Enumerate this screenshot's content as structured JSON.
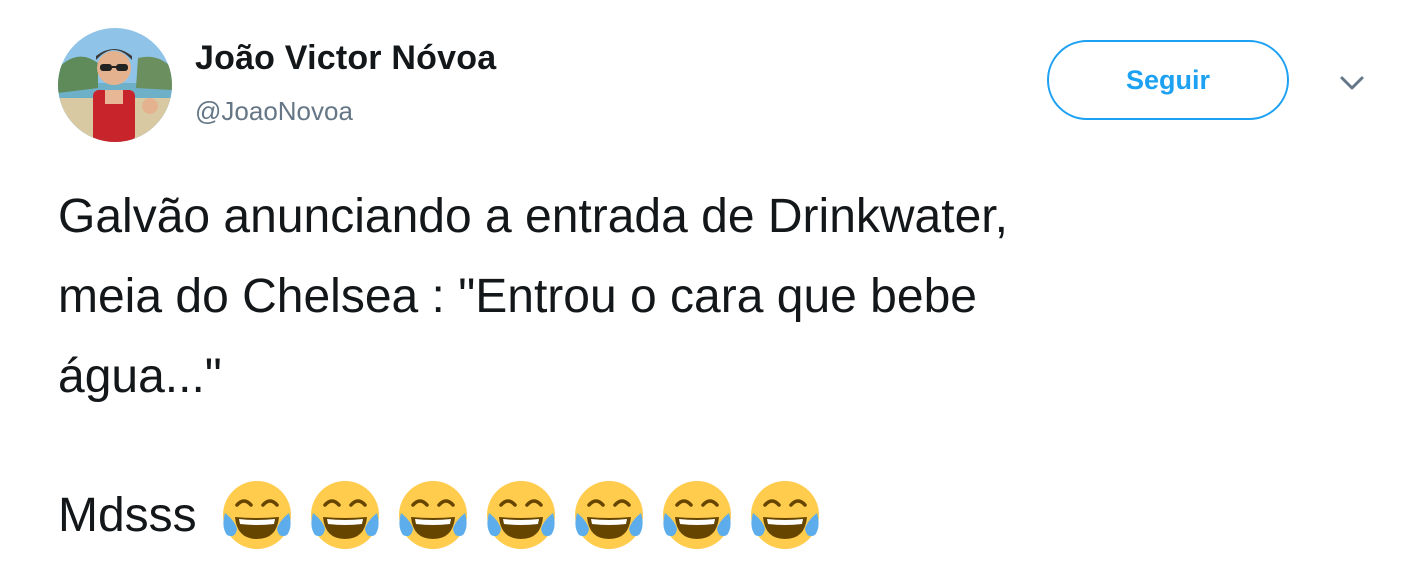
{
  "author": {
    "name": "João Victor Nóvoa",
    "handle": "@JoaoNovoa",
    "avatar": "profile-photo-beach"
  },
  "follow_button": {
    "label": "Seguir"
  },
  "menu": {
    "icon": "chevron-down-icon"
  },
  "tweet": {
    "text": "Galvão anunciando a entrada de Drinkwater,\nmeia do Chelsea : \"Entrou o cara que bebe\nágua...\"",
    "closing_word": "Mdsss",
    "emojis": [
      "face-with-tears-of-joy",
      "face-with-tears-of-joy",
      "face-with-tears-of-joy",
      "face-with-tears-of-joy",
      "face-with-tears-of-joy",
      "face-with-tears-of-joy",
      "face-with-tears-of-joy"
    ]
  },
  "colors": {
    "accent": "#1da1f2",
    "text": "#14171a",
    "secondary": "#657786"
  }
}
